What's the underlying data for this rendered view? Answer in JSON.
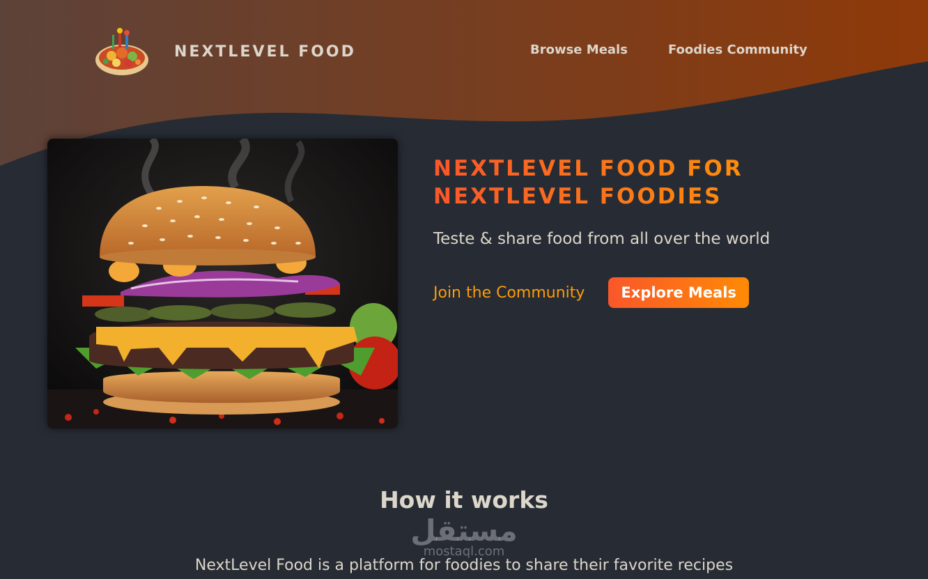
{
  "header": {
    "logo_text": "NextLevel Food",
    "nav": [
      {
        "label": "Browse Meals"
      },
      {
        "label": "Foodies Community"
      }
    ]
  },
  "hero": {
    "title": "NextLevel Food for NextLevel Foodies",
    "subtitle": "Teste & share food from all over the world",
    "join_link": "Join the Community",
    "explore_button": "Explore Meals"
  },
  "how_it_works": {
    "title": "How it works",
    "text": "NextLevel Food is a platform for foodies to share their favorite recipes"
  },
  "watermark": {
    "text": "مستقل",
    "domain": "mostaql.com"
  },
  "colors": {
    "background": "#282c34",
    "header_gradient_start": "#5d4239",
    "header_gradient_end": "#8f3a09",
    "accent_orange": "#f9572a",
    "accent_amber": "#ff9b05",
    "text_light": "#ddd6cb"
  },
  "icons": {
    "logo": "food-plate-icon",
    "hero_image": "burger-image"
  }
}
